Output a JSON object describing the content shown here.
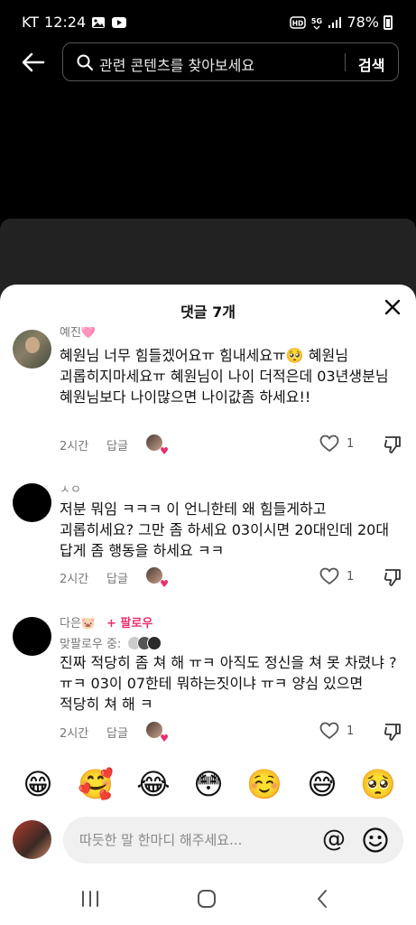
{
  "status_bar": {
    "carrier": "KT",
    "time": "12:24",
    "hd_badge": "HD",
    "network": "5G",
    "battery": "78%",
    "icons": [
      "photo-icon",
      "youtube-icon",
      "hd-voice-icon",
      "5g-icon",
      "signal-icon",
      "battery-icon"
    ]
  },
  "top_bar": {
    "search_placeholder": "관련 콘텐츠를 찾아보세요",
    "search_button": "검색"
  },
  "sheet": {
    "title": "댓글 7개"
  },
  "comments": [
    {
      "username": "예진🩷",
      "text": "혜원님 너무 힘들겠어요ㅠ 힘내세요ㅠ🥺 혜원님 괴롭히지마세요ㅠ 혜원님이 나이 더적은데 03년생분님 혜원님보다 나이많으면 나이값좀 하세요!!",
      "time": "2시간",
      "reply": "답글",
      "likes": "1"
    },
    {
      "username": "ㅅㅇ",
      "text": "저분 뭐임 ㅋㅋㅋ 이 언니한테 왜 힘들게하고 괴롭히세요? 그만 좀 하세요 03이시면 20대인데 20대 답게 좀 행동을 하세요 ㅋㅋ",
      "time": "2시간",
      "reply": "답글",
      "likes": "1"
    },
    {
      "username": "다은🐷",
      "follow": "+ 팔로우",
      "mutual": "맞팔로우 중:",
      "text": "진짜 적당히 좀 쳐 해 ㅠㅋ 아직도 정신을 쳐 못 차렸냐 ? ㅠㅋ 03이 07한테 뭐하는짓이냐 ㅠㅋ 양심 있으면 적당히 쳐 해 ㅋ",
      "time": "2시간",
      "reply": "답글",
      "likes": "1"
    }
  ],
  "emoji_bar": [
    "😁",
    "🥰",
    "😂",
    "😳",
    "☺️",
    "😅",
    "🥺"
  ],
  "input": {
    "placeholder": "따듯한 말 한마디 해주세요...",
    "mention": "@"
  },
  "colors": {
    "accent": "#e8306b",
    "muted_text": "#777777",
    "input_bg": "#f0f0f0"
  }
}
